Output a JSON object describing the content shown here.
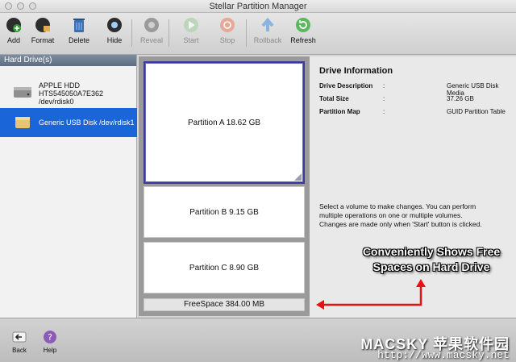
{
  "window": {
    "title": "Stellar Partition Manager"
  },
  "toolbar": {
    "add": "Add",
    "format": "Format",
    "delete": "Delete",
    "hide": "Hide",
    "reveal": "Reveal",
    "start": "Start",
    "stop": "Stop",
    "rollback": "Rollback",
    "refresh": "Refresh"
  },
  "sidebar": {
    "header": "Hard Drive(s)",
    "drives": [
      {
        "label": "APPLE HDD\nHTS545050A7E362\n/dev/rdisk0",
        "selected": false
      },
      {
        "label": "Generic USB Disk /dev/rdisk1",
        "selected": true
      }
    ]
  },
  "partitions": [
    {
      "label": "Partition A  18.62 GB",
      "selected": true
    },
    {
      "label": "Partition B  9.15 GB",
      "selected": false
    },
    {
      "label": "Partition C  8.90 GB",
      "selected": false
    }
  ],
  "freespace": "FreeSpace 384.00 MB",
  "info": {
    "title": "Drive Information",
    "rows": [
      {
        "key": "Drive Description",
        "value": "Generic USB Disk Media"
      },
      {
        "key": "Total Size",
        "value": "37.26 GB"
      },
      {
        "key": "Partition Map",
        "value": "GUID Partition Table"
      }
    ],
    "sep": ":",
    "help_line1": "Select a volume to make changes. You can perform",
    "help_line2": "multiple operations on one  or  multiple volumes.",
    "help_line3": "Changes are made only when 'Start' button is clicked."
  },
  "annotation": {
    "line1": "Conveniently Shows Free",
    "line2": "Spaces on Hard Drive",
    "color": "#e81010"
  },
  "bottombar": {
    "back": "Back",
    "help": "Help"
  },
  "watermark": {
    "line1": "MACSKY 苹果软件园",
    "line2": "http://www.macsky.net"
  }
}
